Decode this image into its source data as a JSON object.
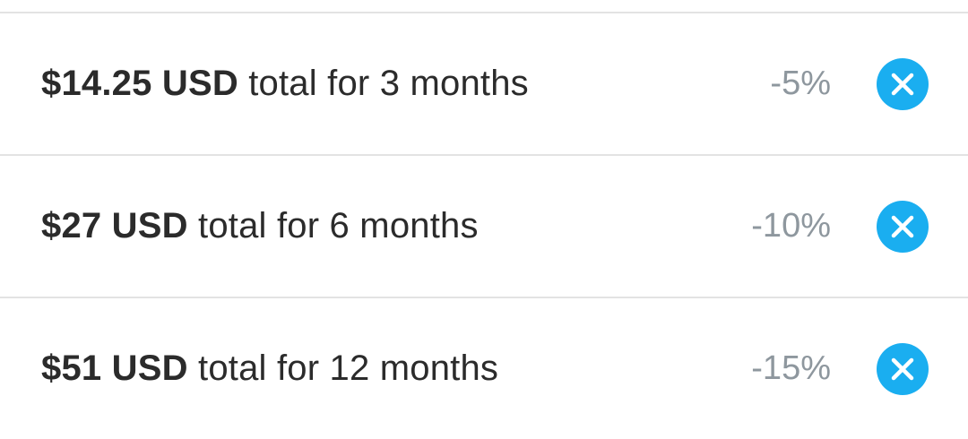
{
  "plans": [
    {
      "price": "$14.25 USD",
      "description": " total for 3 months",
      "discount": "-5%",
      "remove_icon": "close-icon",
      "accent_color": "#1aaef0"
    },
    {
      "price": "$27 USD",
      "description": " total for 6 months",
      "discount": "-10%",
      "remove_icon": "close-icon",
      "accent_color": "#1aaef0"
    },
    {
      "price": "$51 USD",
      "description": " total for 12 months",
      "discount": "-15%",
      "remove_icon": "close-icon",
      "accent_color": "#1aaef0"
    }
  ]
}
